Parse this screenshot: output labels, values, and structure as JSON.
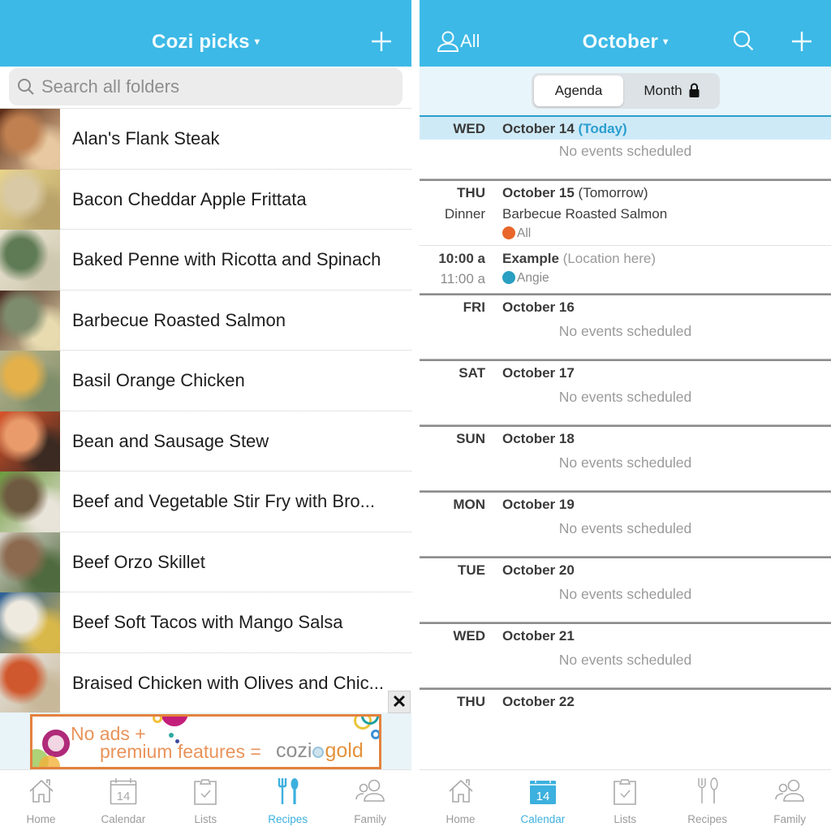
{
  "left": {
    "header": {
      "title": "Cozi picks",
      "caret": "▾",
      "add_icon": "plus-icon"
    },
    "search": {
      "placeholder": "Search all folders",
      "value": ""
    },
    "recipes": [
      {
        "name": "Alan's Flank Steak",
        "thumb_colors": [
          "#5a2a14",
          "#c08050",
          "#e7c8a0"
        ]
      },
      {
        "name": "Bacon Cheddar Apple Frittata",
        "thumb_colors": [
          "#e8d48a",
          "#d9c9a5",
          "#b9a36a"
        ]
      },
      {
        "name": "Baked Penne with Ricotta and Spinach",
        "thumb_colors": [
          "#e9e4d2",
          "#5f7b55",
          "#cfc8b0"
        ]
      },
      {
        "name": "Barbecue Roasted Salmon",
        "thumb_colors": [
          "#4a2c22",
          "#7e8c6e",
          "#e8dbb0"
        ]
      },
      {
        "name": "Basil Orange Chicken",
        "thumb_colors": [
          "#b8b48e",
          "#e3b04a",
          "#7f8e6a"
        ]
      },
      {
        "name": "Bean and Sausage Stew",
        "thumb_colors": [
          "#d9532a",
          "#e99b6b",
          "#3a2a22"
        ]
      },
      {
        "name": "Beef and Vegetable Stir Fry with Bro...",
        "thumb_colors": [
          "#6b9a3c",
          "#6e5a40",
          "#e9e4da"
        ]
      },
      {
        "name": "Beef Orzo Skillet",
        "thumb_colors": [
          "#d7d2c8",
          "#8c6a50",
          "#4f6a3e"
        ]
      },
      {
        "name": "Beef Soft Tacos with Mango Salsa",
        "thumb_colors": [
          "#2a5f9a",
          "#efeae0",
          "#d9b84a"
        ]
      },
      {
        "name": "Braised Chicken with Olives and Chic...",
        "thumb_colors": [
          "#e8e6e2",
          "#d0582e",
          "#c8b89a"
        ]
      }
    ],
    "ad": {
      "close_label": "✕",
      "line1": "No ads +",
      "line2": "premium features =",
      "brand_cozi": "cozi",
      "brand_gold": "gold"
    },
    "tabbar": [
      {
        "label": "Home",
        "icon": "home-icon",
        "active": false
      },
      {
        "label": "Calendar",
        "icon": "calendar-icon",
        "badge": "14",
        "active": false
      },
      {
        "label": "Lists",
        "icon": "clipboard-icon",
        "active": false
      },
      {
        "label": "Recipes",
        "icon": "fork-spoon-icon",
        "active": true
      },
      {
        "label": "Family",
        "icon": "family-icon",
        "active": false
      }
    ]
  },
  "right": {
    "header": {
      "filter_label": "All",
      "title": "October",
      "caret": "▾",
      "search_icon": "search-icon",
      "add_icon": "plus-icon"
    },
    "segments": {
      "agenda": "Agenda",
      "month": "Month",
      "selected": "Agenda",
      "month_locked": true
    },
    "days": [
      {
        "dow": "WED",
        "date": "October 14",
        "suffix": "(Today)",
        "today": true,
        "events": [],
        "empty_text": "No events scheduled"
      },
      {
        "dow": "THU",
        "date": "October 15",
        "suffix": "(Tomorrow)",
        "today": false,
        "events": [
          {
            "time": "Dinner",
            "title": "Barbecue Roasted Salmon",
            "location": "",
            "who": "All",
            "who_color": "#e8662a"
          },
          {
            "time": "10:00 a",
            "end_time": "11:00 a",
            "title": "Example",
            "location": "(Location here)",
            "who": "Angie",
            "who_color": "#2a9fc1"
          }
        ]
      },
      {
        "dow": "FRI",
        "date": "October 16",
        "suffix": "",
        "events": [],
        "empty_text": "No events scheduled"
      },
      {
        "dow": "SAT",
        "date": "October 17",
        "suffix": "",
        "events": [],
        "empty_text": "No events scheduled"
      },
      {
        "dow": "SUN",
        "date": "October 18",
        "suffix": "",
        "events": [],
        "empty_text": "No events scheduled"
      },
      {
        "dow": "MON",
        "date": "October 19",
        "suffix": "",
        "events": [],
        "empty_text": "No events scheduled"
      },
      {
        "dow": "TUE",
        "date": "October 20",
        "suffix": "",
        "events": [],
        "empty_text": "No events scheduled"
      },
      {
        "dow": "WED",
        "date": "October 21",
        "suffix": "",
        "events": [],
        "empty_text": "No events scheduled"
      },
      {
        "dow": "THU",
        "date": "October 22",
        "suffix": "",
        "events": []
      }
    ],
    "tabbar": [
      {
        "label": "Home",
        "icon": "home-icon",
        "active": false
      },
      {
        "label": "Calendar",
        "icon": "calendar-icon",
        "badge": "14",
        "active": true
      },
      {
        "label": "Lists",
        "icon": "clipboard-icon",
        "active": false
      },
      {
        "label": "Recipes",
        "icon": "fork-spoon-icon",
        "active": false
      },
      {
        "label": "Family",
        "icon": "family-icon",
        "active": false
      }
    ]
  },
  "colors": {
    "brand": "#3cb9e6",
    "active_tab": "#3cb0de",
    "today_bg": "#cfeaf7",
    "today_text": "#2b9fd0",
    "ad_border": "#e3823e"
  }
}
